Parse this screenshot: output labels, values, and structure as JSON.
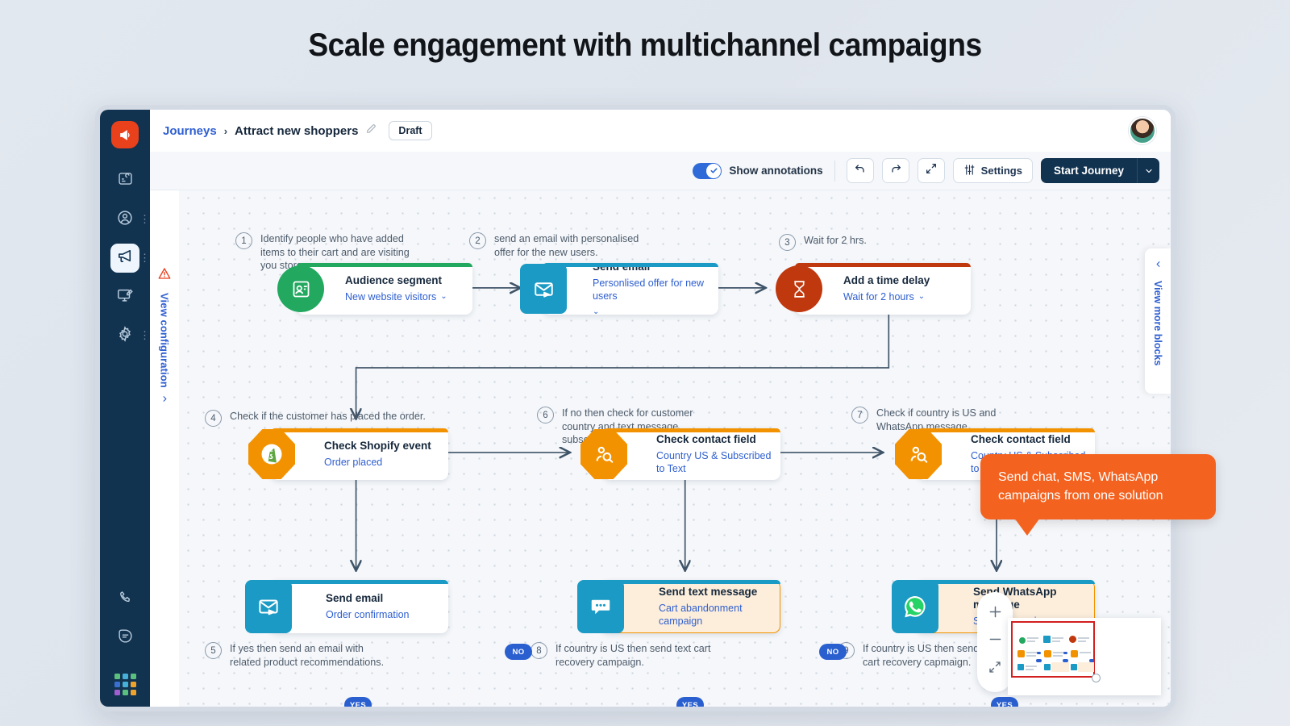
{
  "hero": {
    "title": "Scale engagement with multichannel campaigns"
  },
  "colors": {
    "brand_orange": "#e8411c",
    "callout_orange": "#f4621f",
    "navy": "#123350",
    "link_blue": "#2f5fd0",
    "pill_blue": "#2a5fd0",
    "green": "#22a85f",
    "teal": "#1a9ac4",
    "amber": "#f39200",
    "red": "#c0380d"
  },
  "rail": {
    "logo_icon": "megaphone-logo-icon",
    "items": [
      {
        "icon": "dashboard-icon",
        "name": "sidebar-item-dashboard",
        "active": false,
        "dots": false
      },
      {
        "icon": "contacts-icon",
        "name": "sidebar-item-contacts",
        "active": false,
        "dots": true
      },
      {
        "icon": "campaigns-megaphone-icon",
        "name": "sidebar-item-campaigns",
        "active": true,
        "dots": true
      },
      {
        "icon": "content-editor-icon",
        "name": "sidebar-item-content",
        "active": false,
        "dots": false
      },
      {
        "icon": "gear-icon",
        "name": "sidebar-item-settings",
        "active": false,
        "dots": true
      }
    ],
    "bottom_items": [
      {
        "icon": "phone-icon",
        "name": "sidebar-item-calls"
      },
      {
        "icon": "chat-icon",
        "name": "sidebar-item-chat"
      }
    ],
    "app_grid_icon": "app-grid-icon",
    "app_grid_colors": [
      "#5bbf7d",
      "#46b0d8",
      "#5bbf7d",
      "#3a6fd0",
      "#46b0d8",
      "#f0a32a",
      "#a05ed0",
      "#5bbf7d",
      "#f0a32a"
    ]
  },
  "topbar": {
    "breadcrumb_root": "Journeys",
    "breadcrumb_sep": "›",
    "breadcrumb_current": "Attract new shoppers",
    "edit_icon": "pencil-icon",
    "status_chip": "Draft",
    "avatar_name": "user-avatar"
  },
  "toolbar": {
    "annotations_toggle_label": "Show annotations",
    "annotations_toggle_on": true,
    "undo_icon": "undo-arrow-icon",
    "redo_icon": "redo-arrow-icon",
    "expand_icon": "expand-diagonal-icon",
    "settings_icon": "sliders-icon",
    "settings_label": "Settings",
    "primary_label": "Start Journey",
    "primary_caret_icon": "chevron-down-icon"
  },
  "config_panel": {
    "warning_icon": "warning-triangle-icon",
    "label": "View configuration",
    "caret_icon": "chevron-right-icon"
  },
  "blocks_panel": {
    "caret_icon": "chevron-left-icon",
    "label": "View more blocks"
  },
  "annotations": [
    {
      "num": "1",
      "text": "Identify people who have added items to their cart and are visiting you store."
    },
    {
      "num": "2",
      "text": "send an email with personalised offer for the new users."
    },
    {
      "num": "3",
      "text": "Wait for 2 hrs."
    },
    {
      "num": "4",
      "text": "Check if the customer has placed the order."
    },
    {
      "num": "5",
      "text": "If yes then send an email with related product recommendations."
    },
    {
      "num": "6",
      "text": "If no then check for customer country and text message subscription status."
    },
    {
      "num": "7",
      "text": "Check if country is US and WhatsApp message.."
    },
    {
      "num": "8",
      "text": "If country is US then send text cart recovery campaign."
    },
    {
      "num": "9",
      "text": "If country is US then send WhatsApp cart recovery capmaign."
    }
  ],
  "nodes": [
    {
      "id": "audience-segment",
      "title": "Audience segment",
      "subtitle": "New website visitors",
      "has_caret": true,
      "icon": "audience-segment-icon",
      "accent": "#22a85f",
      "badge_color": "#22a85f",
      "badge_shape": "circle",
      "card_bg": "#ffffff"
    },
    {
      "id": "send-email-offer",
      "title": "Send email",
      "subtitle": "Personlised offer for new users",
      "has_caret": true,
      "icon": "email-send-icon",
      "accent": "#1a9ac4",
      "badge_color": "#1a9ac4",
      "badge_shape": "square",
      "card_bg": "#ffffff"
    },
    {
      "id": "time-delay",
      "title": "Add a time delay",
      "subtitle": "Wait for 2 hours",
      "has_caret": true,
      "icon": "hourglass-icon",
      "accent": "#c0380d",
      "badge_color": "#c0380d",
      "badge_shape": "circle",
      "card_bg": "#ffffff"
    },
    {
      "id": "check-shopify-event",
      "title": "Check Shopify event",
      "subtitle": "Order placed",
      "has_caret": false,
      "icon": "shopify-bag-icon",
      "accent": "#f39200",
      "badge_color": "#f39200",
      "badge_shape": "octagon",
      "card_bg": "#ffffff"
    },
    {
      "id": "check-contact-field-text",
      "title": "Check contact field",
      "subtitle": "Country US & Subscribed to Text",
      "has_caret": false,
      "icon": "contact-search-icon",
      "accent": "#f39200",
      "badge_color": "#f39200",
      "badge_shape": "octagon",
      "card_bg": "#ffffff"
    },
    {
      "id": "check-contact-field-whatsapp",
      "title": "Check contact field",
      "subtitle": "Country US & Subscribed to WhatsApp",
      "has_caret": false,
      "icon": "contact-search-icon",
      "accent": "#f39200",
      "badge_color": "#f39200",
      "badge_shape": "octagon",
      "card_bg": "#ffffff"
    },
    {
      "id": "send-email-confirmation",
      "title": "Send email",
      "subtitle": "Order confirmation",
      "has_caret": false,
      "icon": "email-send-icon",
      "accent": "#1a9ac4",
      "badge_color": "#1a9ac4",
      "badge_shape": "square",
      "card_bg": "#ffffff"
    },
    {
      "id": "send-text-message",
      "title": "Send text message",
      "subtitle": "Cart abandonment campaign",
      "has_caret": false,
      "icon": "sms-bubble-icon",
      "accent": "#f39200",
      "badge_color": "#1a9ac4",
      "badge_shape": "square",
      "card_bg": "#fdeedb"
    },
    {
      "id": "send-whatsapp-message",
      "title": "Send WhatsApp message",
      "subtitle": "Select campaign",
      "has_caret": false,
      "icon": "whatsapp-icon",
      "accent": "#1a9ac4",
      "badge_color": "#1a9ac4",
      "badge_shape": "square",
      "card_bg": "#fdeedb"
    }
  ],
  "edge_labels": {
    "no1": "NO",
    "no2": "NO",
    "yes1": "YES",
    "yes2": "YES",
    "yes3": "YES"
  },
  "callout": {
    "text": "Send chat, SMS, WhatsApp campaigns from one solution"
  },
  "zoom_controls": {
    "zoom_in_icon": "plus-icon",
    "zoom_out_icon": "minus-icon",
    "fit_icon": "fit-screen-icon"
  },
  "minimap": {
    "name": "canvas-minimap"
  }
}
